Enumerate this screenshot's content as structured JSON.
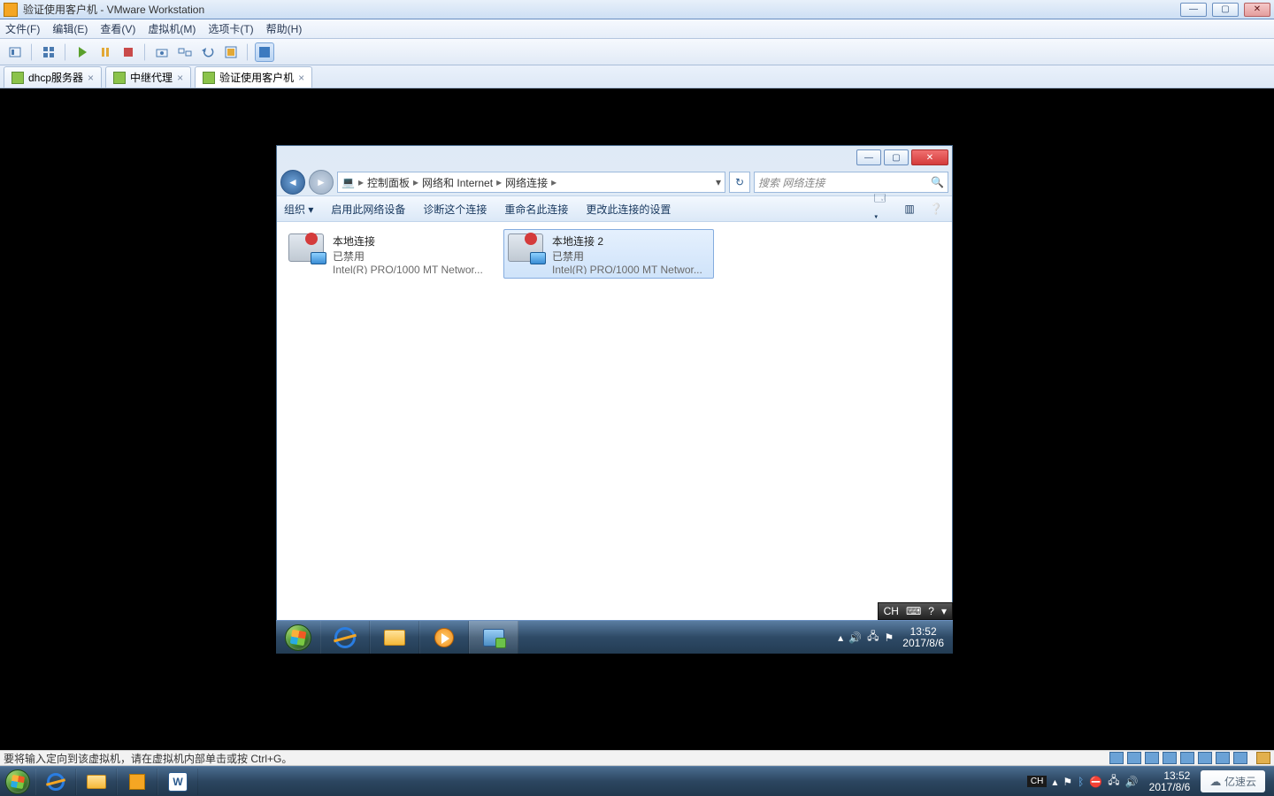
{
  "vmware": {
    "title": "验证使用客户机 - VMware Workstation",
    "menu": {
      "file": "文件(F)",
      "edit": "编辑(E)",
      "view": "查看(V)",
      "vm": "虚拟机(M)",
      "tabs": "选项卡(T)",
      "help": "帮助(H)"
    },
    "tabs": [
      {
        "label": "dhcp服务器",
        "active": false
      },
      {
        "label": "中继代理",
        "active": false
      },
      {
        "label": "验证使用客户机",
        "active": true
      }
    ],
    "statusnote": "要将输入定向到该虚拟机，请在虚拟机内部单击或按 Ctrl+G。"
  },
  "guest_window": {
    "breadcrumb": [
      "控制面板",
      "网络和 Internet",
      "网络连接"
    ],
    "search_placeholder": "搜索 网络连接",
    "cmdbar": {
      "organize": "组织 ▾",
      "enable": "启用此网络设备",
      "diagnose": "诊断这个连接",
      "rename": "重命名此连接",
      "change": "更改此连接的设置"
    },
    "items": [
      {
        "name": "本地连接",
        "status": "已禁用",
        "adapter": "Intel(R) PRO/1000 MT Networ...",
        "selected": false
      },
      {
        "name": "本地连接 2",
        "status": "已禁用",
        "adapter": "Intel(R) PRO/1000 MT Networ...",
        "selected": true
      }
    ],
    "langbar": "CH"
  },
  "guest_taskbar": {
    "time": "13:52",
    "date": "2017/8/6"
  },
  "host_taskbar": {
    "time": "13:52",
    "date": "2017/8/6",
    "ime": "CH",
    "logo": "亿速云"
  }
}
